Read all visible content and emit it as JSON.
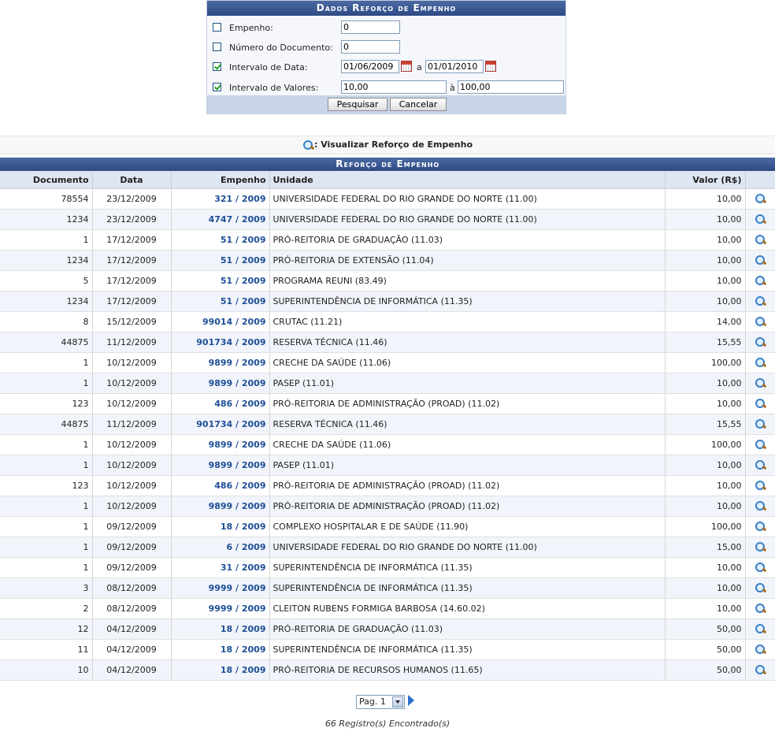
{
  "form": {
    "title": "Dados Reforço de Empenho",
    "empenho": {
      "label": "Empenho:",
      "value": "0",
      "checked": false
    },
    "numero_documento": {
      "label": "Número do Documento:",
      "value": "0",
      "checked": false
    },
    "intervalo_data": {
      "label": "Intervalo de Data:",
      "from": "01/06/2009",
      "sep": "a",
      "to": "01/01/2010",
      "checked": true
    },
    "intervalo_valores": {
      "label": "Intervalo de Valores:",
      "from": "10,00",
      "sep": "à",
      "to": "100,00",
      "checked": true
    },
    "search_button": "Pesquisar",
    "cancel_button": "Cancelar"
  },
  "legend": {
    "text": ": Visualizar Reforço de Empenho",
    "icon": "magnifier-icon"
  },
  "table": {
    "caption": "Reforço de Empenho",
    "headers": [
      "Documento",
      "Data",
      "Empenho",
      "Unidade",
      "Valor (R$)"
    ],
    "rows": [
      {
        "documento": "78554",
        "data": "23/12/2009",
        "empenho": "321 / 2009",
        "unidade": "UNIVERSIDADE FEDERAL DO RIO GRANDE DO NORTE (11.00)",
        "valor": "10,00"
      },
      {
        "documento": "1234",
        "data": "23/12/2009",
        "empenho": "4747 / 2009",
        "unidade": "UNIVERSIDADE FEDERAL DO RIO GRANDE DO NORTE (11.00)",
        "valor": "10,00"
      },
      {
        "documento": "1",
        "data": "17/12/2009",
        "empenho": "51 / 2009",
        "unidade": "PRÓ-REITORIA DE GRADUAÇÃO (11.03)",
        "valor": "10,00"
      },
      {
        "documento": "1234",
        "data": "17/12/2009",
        "empenho": "51 / 2009",
        "unidade": "PRÓ-REITORIA DE EXTENSÃO (11.04)",
        "valor": "10,00"
      },
      {
        "documento": "5",
        "data": "17/12/2009",
        "empenho": "51 / 2009",
        "unidade": "PROGRAMA REUNI (83.49)",
        "valor": "10,00"
      },
      {
        "documento": "1234",
        "data": "17/12/2009",
        "empenho": "51 / 2009",
        "unidade": "SUPERINTENDÊNCIA DE INFORMÁTICA (11.35)",
        "valor": "10,00"
      },
      {
        "documento": "8",
        "data": "15/12/2009",
        "empenho": "99014 / 2009",
        "unidade": "CRUTAC (11.21)",
        "valor": "14,00"
      },
      {
        "documento": "44875",
        "data": "11/12/2009",
        "empenho": "901734 / 2009",
        "unidade": "RESERVA TÉCNICA (11.46)",
        "valor": "15,55"
      },
      {
        "documento": "1",
        "data": "10/12/2009",
        "empenho": "9899 / 2009",
        "unidade": "CRECHE DA SAÚDE (11.06)",
        "valor": "100,00"
      },
      {
        "documento": "1",
        "data": "10/12/2009",
        "empenho": "9899 / 2009",
        "unidade": "PASEP (11.01)",
        "valor": "10,00"
      },
      {
        "documento": "123",
        "data": "10/12/2009",
        "empenho": "486 / 2009",
        "unidade": "PRÓ-REITORIA DE ADMINISTRAÇÃO (PROAD) (11.02)",
        "valor": "10,00"
      },
      {
        "documento": "44875",
        "data": "11/12/2009",
        "empenho": "901734 / 2009",
        "unidade": "RESERVA TÉCNICA (11.46)",
        "valor": "15,55"
      },
      {
        "documento": "1",
        "data": "10/12/2009",
        "empenho": "9899 / 2009",
        "unidade": "CRECHE DA SAÚDE (11.06)",
        "valor": "100,00"
      },
      {
        "documento": "1",
        "data": "10/12/2009",
        "empenho": "9899 / 2009",
        "unidade": "PASEP (11.01)",
        "valor": "10,00"
      },
      {
        "documento": "123",
        "data": "10/12/2009",
        "empenho": "486 / 2009",
        "unidade": "PRÓ-REITORIA DE ADMINISTRAÇÃO (PROAD) (11.02)",
        "valor": "10,00"
      },
      {
        "documento": "1",
        "data": "10/12/2009",
        "empenho": "9899 / 2009",
        "unidade": "PRÓ-REITORIA DE ADMINISTRAÇÃO (PROAD) (11.02)",
        "valor": "10,00"
      },
      {
        "documento": "1",
        "data": "09/12/2009",
        "empenho": "18 / 2009",
        "unidade": "COMPLEXO HOSPITALAR E DE SAÚDE (11.90)",
        "valor": "100,00"
      },
      {
        "documento": "1",
        "data": "09/12/2009",
        "empenho": "6 / 2009",
        "unidade": "UNIVERSIDADE FEDERAL DO RIO GRANDE DO NORTE (11.00)",
        "valor": "15,00"
      },
      {
        "documento": "1",
        "data": "09/12/2009",
        "empenho": "31 / 2009",
        "unidade": "SUPERINTENDÊNCIA DE INFORMÁTICA (11.35)",
        "valor": "10,00"
      },
      {
        "documento": "3",
        "data": "08/12/2009",
        "empenho": "9999 / 2009",
        "unidade": "SUPERINTENDÊNCIA DE INFORMÁTICA (11.35)",
        "valor": "10,00"
      },
      {
        "documento": "2",
        "data": "08/12/2009",
        "empenho": "9999 / 2009",
        "unidade": "CLEITON RUBENS FORMIGA BARBOSA (14.60.02)",
        "valor": "10,00"
      },
      {
        "documento": "12",
        "data": "04/12/2009",
        "empenho": "18 / 2009",
        "unidade": "PRÓ-REITORIA DE GRADUAÇÃO (11.03)",
        "valor": "50,00"
      },
      {
        "documento": "11",
        "data": "04/12/2009",
        "empenho": "18 / 2009",
        "unidade": "SUPERINTENDÊNCIA DE INFORMÁTICA (11.35)",
        "valor": "50,00"
      },
      {
        "documento": "10",
        "data": "04/12/2009",
        "empenho": "18 / 2009",
        "unidade": "PRÓ-REITORIA DE RECURSOS HUMANOS (11.65)",
        "valor": "50,00"
      }
    ]
  },
  "pager": {
    "selected": "Pag. 1",
    "next_icon": "next-arrow-icon"
  },
  "footer": {
    "count": "66 Registro(s) Encontrado(s)"
  }
}
